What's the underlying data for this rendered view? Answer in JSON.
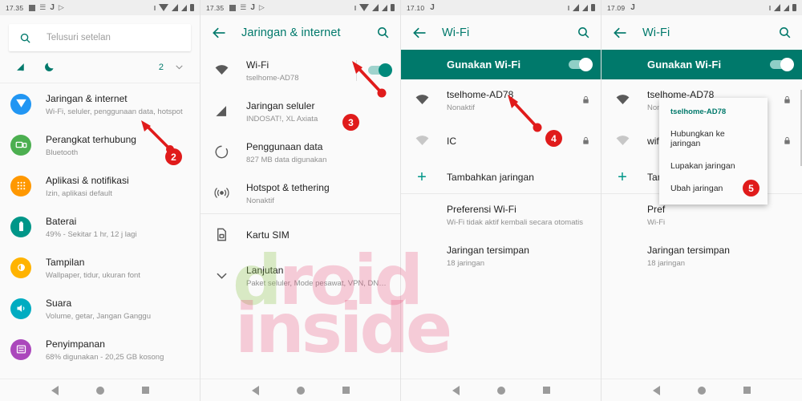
{
  "panels": [
    {
      "id": "settings-home",
      "statusbar": {
        "time": "17.35",
        "left_icons": [
          "square-icon",
          "message-icon",
          "j-icon",
          "play-icon"
        ],
        "right_icons": [
          "wifi-icon",
          "signal-icon",
          "signal-sim-icon"
        ]
      },
      "search": {
        "placeholder": "Telusuri setelan",
        "icon": "search-icon"
      },
      "quickrow": {
        "icons": [
          "signal-off-icon",
          "moon-icon"
        ],
        "count": "2",
        "chevron": "chevron-down-icon"
      },
      "items": [
        {
          "title": "Jaringan & internet",
          "sub": "Wi-Fi, seluler, penggunaan data, hotspot",
          "icon": "network-icon",
          "color": "#2196f3"
        },
        {
          "title": "Perangkat terhubung",
          "sub": "Bluetooth",
          "icon": "devices-icon",
          "color": "#4caf50"
        },
        {
          "title": "Aplikasi & notifikasi",
          "sub": "Izin, aplikasi default",
          "icon": "apps-icon",
          "color": "#ff9800"
        },
        {
          "title": "Baterai",
          "sub": "49% - Sekitar 1 hr, 12 j lagi",
          "icon": "battery-icon",
          "color": "#009688"
        },
        {
          "title": "Tampilan",
          "sub": "Wallpaper, tidur, ukuran font",
          "icon": "display-icon",
          "color": "#ffb300"
        },
        {
          "title": "Suara",
          "sub": "Volume, getar, Jangan Ganggu",
          "icon": "sound-icon",
          "color": "#00acc1"
        },
        {
          "title": "Penyimpanan",
          "sub": "68% digunakan - 20,25 GB kosong",
          "icon": "storage-icon",
          "color": "#ab47bc"
        }
      ]
    },
    {
      "id": "network-internet",
      "statusbar": {
        "time": "17.35",
        "left_icons": [
          "square-icon",
          "message-icon",
          "j-icon",
          "play-icon"
        ],
        "right_icons": [
          "wifi-icon",
          "signal-icon",
          "signal-sim-icon"
        ]
      },
      "appbar": {
        "title": "Jaringan & internet",
        "back": "back-arrow-icon",
        "search": "search-icon"
      },
      "items": [
        {
          "title": "Wi-Fi",
          "sub": "tselhome-AD78",
          "icon": "wifi-icon",
          "toggle": "on"
        },
        {
          "title": "Jaringan seluler",
          "sub": "INDOSAT!, XL Axiata",
          "icon": "cellular-icon"
        },
        {
          "title": "Penggunaan data",
          "sub": "827 MB data digunakan",
          "icon": "data-usage-icon"
        },
        {
          "title": "Hotspot & tethering",
          "sub": "Nonaktif",
          "icon": "hotspot-icon"
        },
        {
          "title": "Kartu SIM",
          "sub": "",
          "icon": "sim-card-icon"
        },
        {
          "title": "Lanjutan",
          "sub": "Paket seluler, Mode pesawat, VPN, DNS Pri..",
          "icon": "chevron-down-icon"
        }
      ]
    },
    {
      "id": "wifi-list",
      "statusbar": {
        "time": "17.10",
        "left_icons": [
          "j-icon"
        ],
        "right_icons": [
          "signal-icon",
          "signal-sim-icon"
        ]
      },
      "appbar": {
        "title": "Wi-Fi",
        "back": "back-arrow-icon",
        "search": "search-icon"
      },
      "banner": {
        "label": "Gunakan Wi-Fi",
        "toggle": "on"
      },
      "networks": [
        {
          "ssid": "tselhome-AD78",
          "sub": "Nonaktif",
          "signal": "strong",
          "locked": true
        },
        {
          "ssid": "IC",
          "sub": "",
          "signal": "weak",
          "locked": true
        }
      ],
      "add_network": {
        "label": "Tambahkan jaringan",
        "icon": "plus-icon"
      },
      "preferences": {
        "title": "Preferensi Wi-Fi",
        "sub": "Wi-Fi tidak aktif kembali secara otomatis"
      },
      "saved": {
        "title": "Jaringan tersimpan",
        "sub": "18 jaringan"
      }
    },
    {
      "id": "wifi-context-menu",
      "statusbar": {
        "time": "17.09",
        "left_icons": [
          "j-icon"
        ],
        "right_icons": [
          "signal-icon",
          "signal-sim-icon"
        ]
      },
      "appbar": {
        "title": "Wi-Fi",
        "back": "back-arrow-icon",
        "search": "search-icon"
      },
      "banner": {
        "label": "Gunakan Wi-Fi",
        "toggle": "on"
      },
      "networks": [
        {
          "ssid": "tselhome-AD78",
          "sub": "Nona",
          "signal": "strong",
          "locked": true
        },
        {
          "ssid": "wifi a",
          "sub": "",
          "signal": "weak",
          "locked": true
        }
      ],
      "add_network": {
        "label": "Tam",
        "icon": "plus-icon"
      },
      "preferences": {
        "title": "Pref",
        "sub": "Wi-Fi"
      },
      "saved": {
        "title": "Jaringan tersimpan",
        "sub": "18 jaringan"
      },
      "popup": {
        "header": "tselhome-AD78",
        "items": [
          "Hubungkan ke jaringan",
          "Lupakan jaringan",
          "Ubah jaringan"
        ]
      }
    }
  ],
  "markers": [
    {
      "number": "2"
    },
    {
      "number": "3"
    },
    {
      "number": "4"
    },
    {
      "number": "5"
    }
  ],
  "watermark": {
    "line1_a": "d",
    "line1_b": "roid",
    "line2": "inside"
  },
  "navbar": {
    "back": "back-nav-icon",
    "home": "home-nav-icon",
    "recents": "recents-nav-icon"
  },
  "colors": {
    "accent": "#00796b",
    "marker": "#e01b1b",
    "banner": "#00796b"
  }
}
